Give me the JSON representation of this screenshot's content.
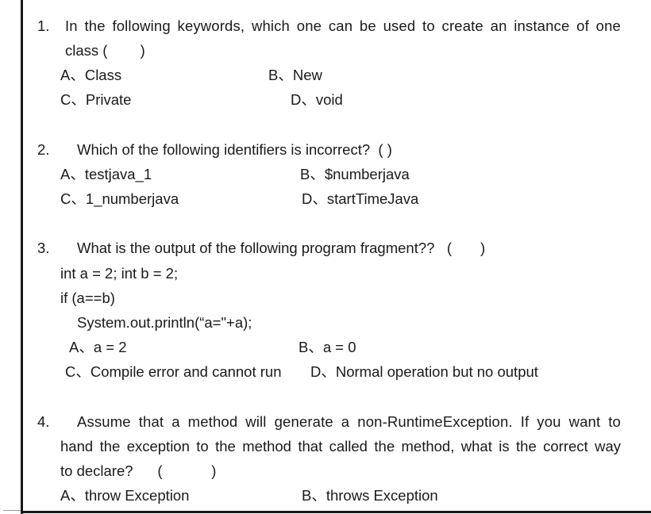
{
  "questions": [
    {
      "number": "1.",
      "text_line1": "In the following keywords, which one can be used to create an instance of one",
      "text_line2": "class (        )",
      "options": {
        "A": "A、Class",
        "B": "B、New",
        "C": "C、Private",
        "D": "D、void"
      }
    },
    {
      "number": "2.",
      "text": "Which of the following identifiers is incorrect?  ( )",
      "options": {
        "A": "A、testjava_1",
        "B": "B、$numberjava",
        "C": "C、1_numberjava",
        "D": "D、startTimeJava"
      }
    },
    {
      "number": "3.",
      "text": "What is the output of the following program fragment??   (       )",
      "code": [
        "int a = 2; int b = 2;",
        "if (a==b)",
        "System.out.println(“a=\"+a);"
      ],
      "options": {
        "A": "A、a = 2",
        "B": "B、a = 0",
        "C": "C、Compile error and cannot run",
        "D": "D、Normal operation but no output"
      }
    },
    {
      "number": "4.",
      "text_line1": "Assume that a method will generate a non-RuntimeException. If you want to",
      "text_line2": "hand the exception to the method that called the method, what is the correct way",
      "text_line3": "to declare?      (            )",
      "options": {
        "A": "A、throw Exception",
        "B": "B、throws Exception"
      }
    }
  ]
}
